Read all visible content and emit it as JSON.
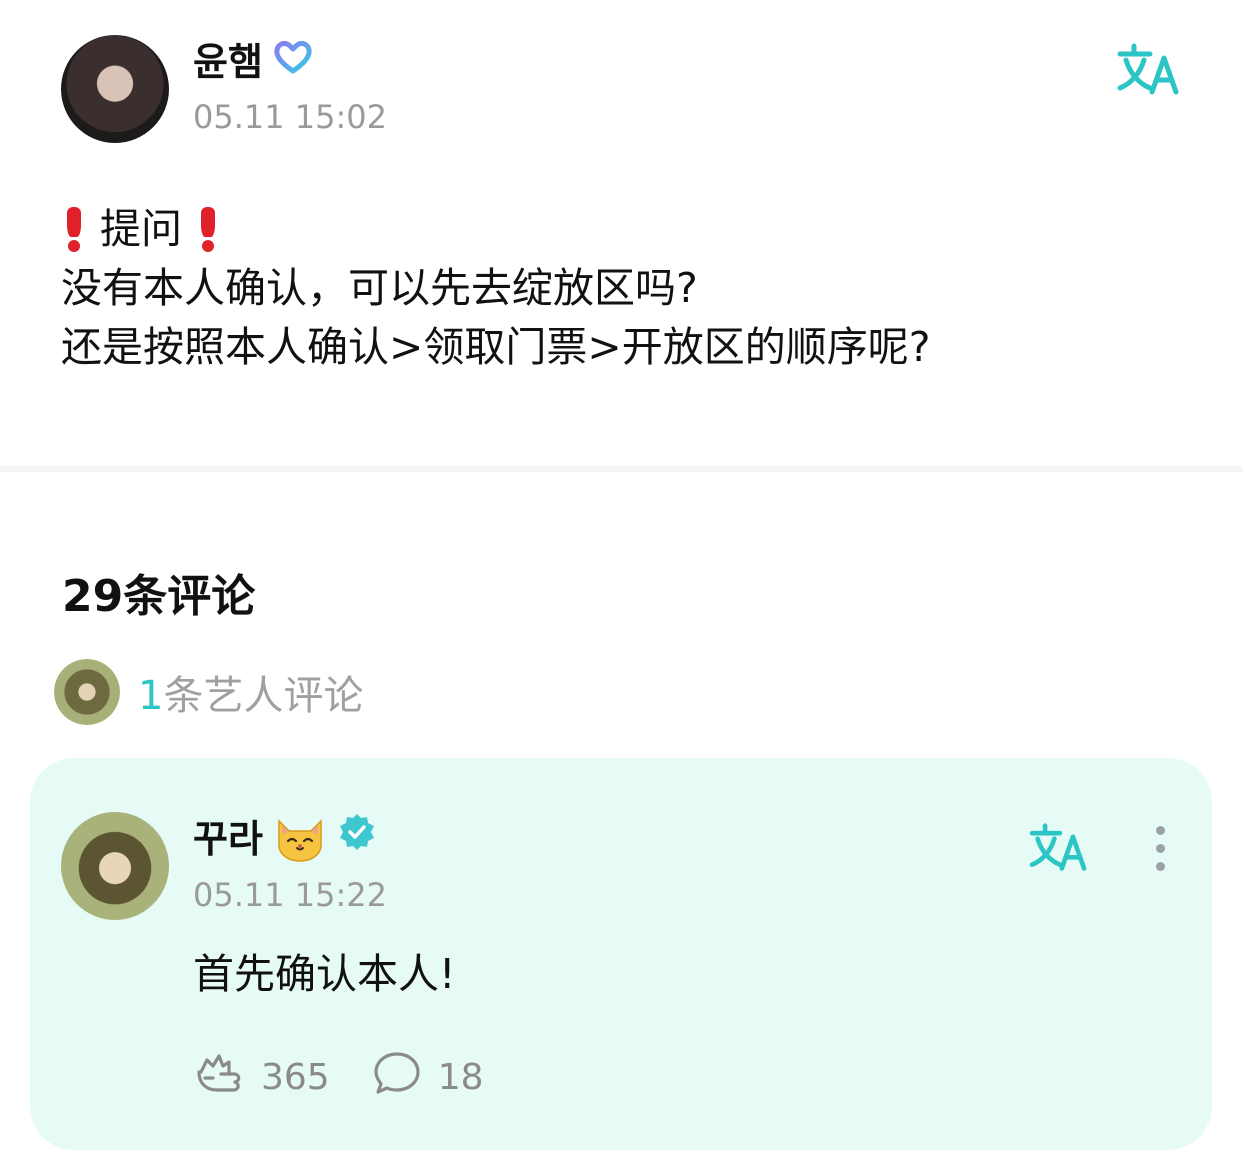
{
  "post": {
    "author": "윤햄",
    "time": "05.11 15:02",
    "title_text": "提问",
    "lines": [
      "没有本人确认，可以先去绽放区吗?",
      "还是按照本人确认>领取门票>开放区的顺序呢?"
    ]
  },
  "comments": {
    "count_label": "29条评论",
    "artist_count": "1",
    "artist_label": "条艺人评论"
  },
  "artist_comment": {
    "author": "꾸라",
    "emoji": "cat-face",
    "time": "05.11 15:22",
    "text": "首先确认本人!",
    "likes": "365",
    "replies": "18"
  },
  "icons": {
    "translate": "translate-icon",
    "verified": "verified-badge-icon",
    "more": "more-vertical-icon",
    "like": "like-icon",
    "reply": "comment-bubble-icon"
  },
  "colors": {
    "accent": "#2cc5c5",
    "card_bg": "#e6fbf6",
    "muted": "#9a9a9a",
    "alert": "#e0202a",
    "verified": "#3fc7d0"
  }
}
